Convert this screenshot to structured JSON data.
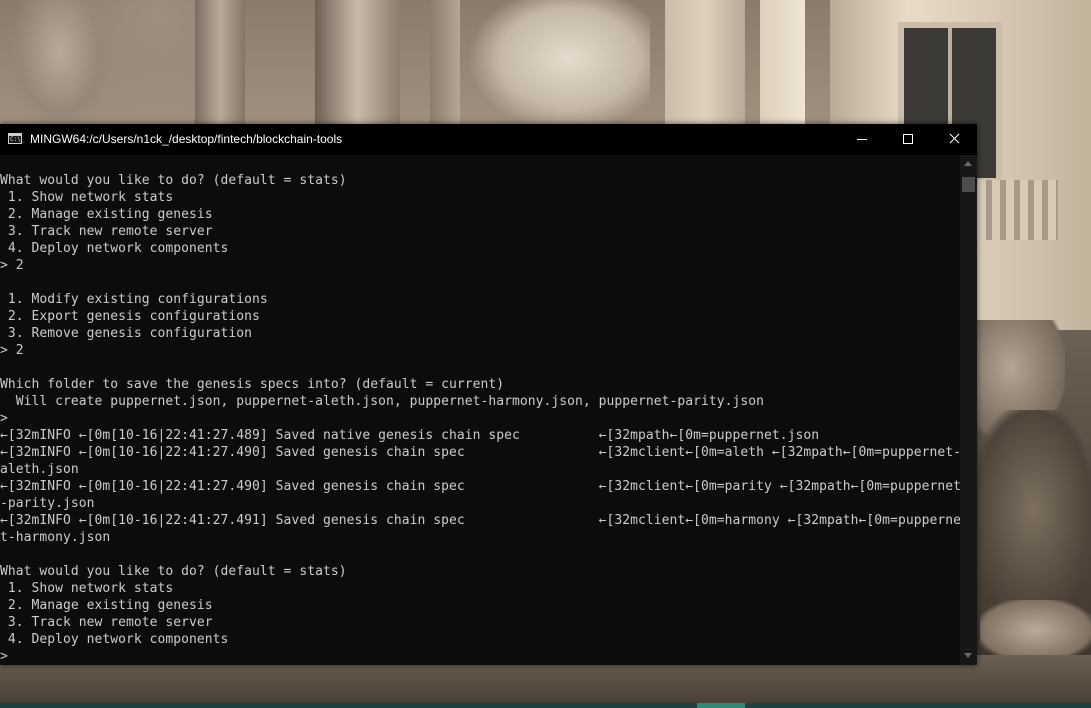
{
  "window": {
    "title": "MINGW64:/c/Users/n1ck_/desktop/fintech/blockchain-tools",
    "icon": "console-app-icon",
    "icon_glyph": "C:\\_"
  },
  "console": {
    "lines": [
      "What would you like to do? (default = stats)",
      " 1. Show network stats",
      " 2. Manage existing genesis",
      " 3. Track new remote server",
      " 4. Deploy network components",
      "> 2",
      "",
      " 1. Modify existing configurations",
      " 2. Export genesis configurations",
      " 3. Remove genesis configuration",
      "> 2",
      "",
      "Which folder to save the genesis specs into? (default = current)",
      "  Will create puppernet.json, puppernet-aleth.json, puppernet-harmony.json, puppernet-parity.json",
      ">",
      "←[32mINFO ←[0m[10-16|22:41:27.489] Saved native genesis chain spec          ←[32mpath←[0m=puppernet.json",
      "←[32mINFO ←[0m[10-16|22:41:27.490] Saved genesis chain spec                 ←[32mclient←[0m=aleth ←[32mpath←[0m=puppernet-aleth.json",
      "←[32mINFO ←[0m[10-16|22:41:27.490] Saved genesis chain spec                 ←[32mclient←[0m=parity ←[32mpath←[0m=puppernet-parity.json",
      "←[32mINFO ←[0m[10-16|22:41:27.491] Saved genesis chain spec                 ←[32mclient←[0m=harmony ←[32mpath←[0m=puppernet-harmony.json",
      "",
      "What would you like to do? (default = stats)",
      " 1. Show network stats",
      " 2. Manage existing genesis",
      " 3. Track new remote server",
      " 4. Deploy network components",
      ">"
    ],
    "columns": 122
  },
  "colors": {
    "console_bg": "#0c0c0c",
    "console_fg": "#cccccc",
    "titlebar_bg": "#000000",
    "titlebar_fg": "#ffffff"
  }
}
